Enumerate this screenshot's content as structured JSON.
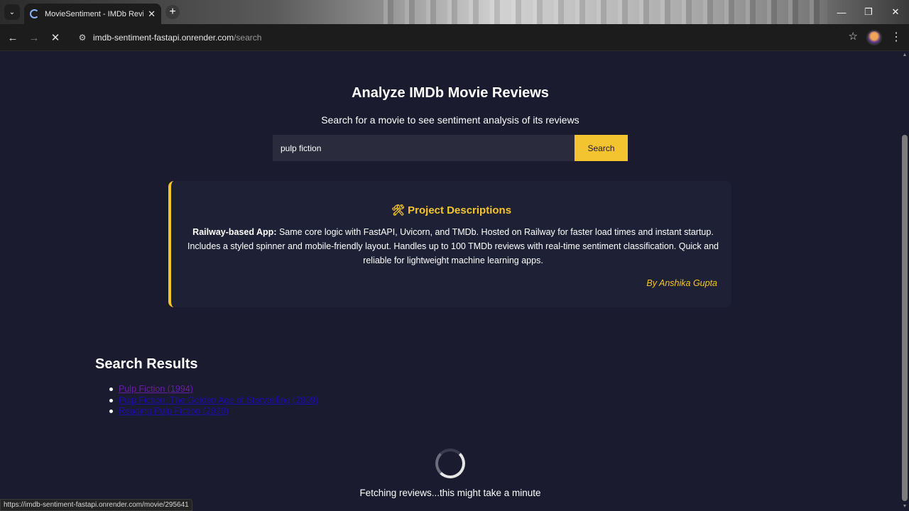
{
  "browser": {
    "tab_title": "MovieSentiment - IMDb Review",
    "tab_close": "✕",
    "new_tab": "+",
    "url_host": "imdb-sentiment-fastapi.onrender.com",
    "url_path": "/search",
    "status_url": "https://imdb-sentiment-fastapi.onrender.com/movie/295641"
  },
  "page": {
    "heading": "Analyze IMDb Movie Reviews",
    "subheading": "Search for a movie to see sentiment analysis of its reviews",
    "search": {
      "value": "pulp fiction",
      "button_label": "Search"
    },
    "project": {
      "title": "🛠 Project Descriptions",
      "bold_lead": "Railway-based App:",
      "description": " Same core logic with FastAPI, Uvicorn, and TMDb. Hosted on Railway for faster load times and instant startup. Includes a styled spinner and mobile-friendly layout. Handles up to 100 TMDb reviews with real-time sentiment classification. Quick and reliable for lightweight machine learning apps.",
      "author": "By Anshika Gupta"
    },
    "results": {
      "heading": "Search Results",
      "items": [
        {
          "label": "Pulp Fiction (1994)",
          "visited": true
        },
        {
          "label": "Pulp Fiction: The Golden Age of Storytelling (2009)",
          "visited": false
        },
        {
          "label": "Reading Pulp Fiction (2020)",
          "visited": false
        }
      ]
    },
    "loading_text": "Fetching reviews...this might take a minute"
  },
  "colors": {
    "background": "#1a1b2e",
    "accent": "#f4c430",
    "card": "#1e2135",
    "link": "#1a0dab",
    "visited_link": "#681da8"
  },
  "icons": {
    "tab_menu": "chevron-down-icon",
    "back": "arrow-left-icon",
    "forward": "arrow-right-icon",
    "stop": "close-icon",
    "site_info": "tune-icon",
    "bookmark": "star-icon",
    "menu": "kebab-icon"
  }
}
